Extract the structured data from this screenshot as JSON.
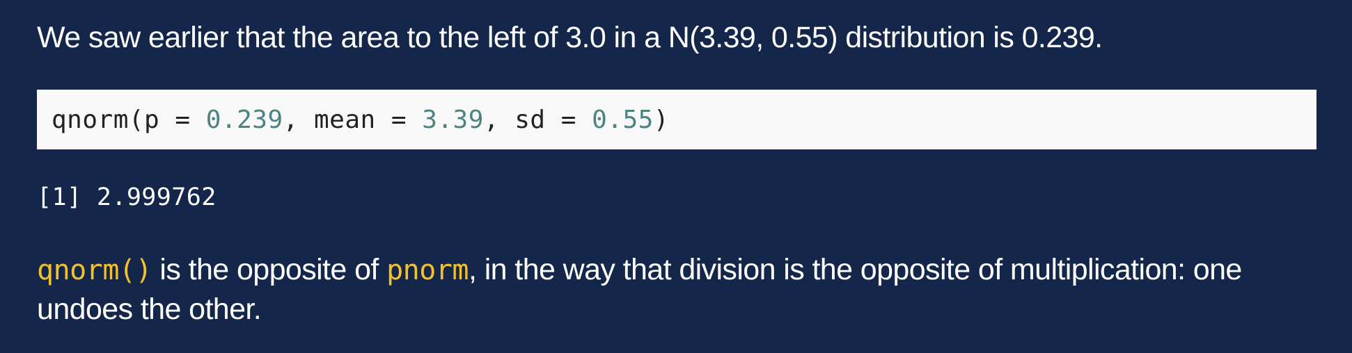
{
  "intro": {
    "text": "We saw earlier that the area to the left of 3.0 in a N(3.39, 0.55) distribution is 0.239."
  },
  "code": {
    "fn_open": "qnorm(p = ",
    "p_value": "0.239",
    "sep_mean": ", mean = ",
    "mean_value": "3.39",
    "sep_sd": ", sd = ",
    "sd_value": "0.55",
    "close": ")"
  },
  "output": {
    "text": "[1] 2.999762"
  },
  "explanation": {
    "code_qnorm": "qnorm()",
    "text_1": " is the opposite of ",
    "code_pnorm": "pnorm",
    "text_2": ", in the way that division is the opposite of multiplication: one undoes the other."
  },
  "colors": {
    "background": "#14274a",
    "code_background": "#f8f8f8",
    "code_number": "#4b8383",
    "inline_code": "#f2c12e"
  }
}
